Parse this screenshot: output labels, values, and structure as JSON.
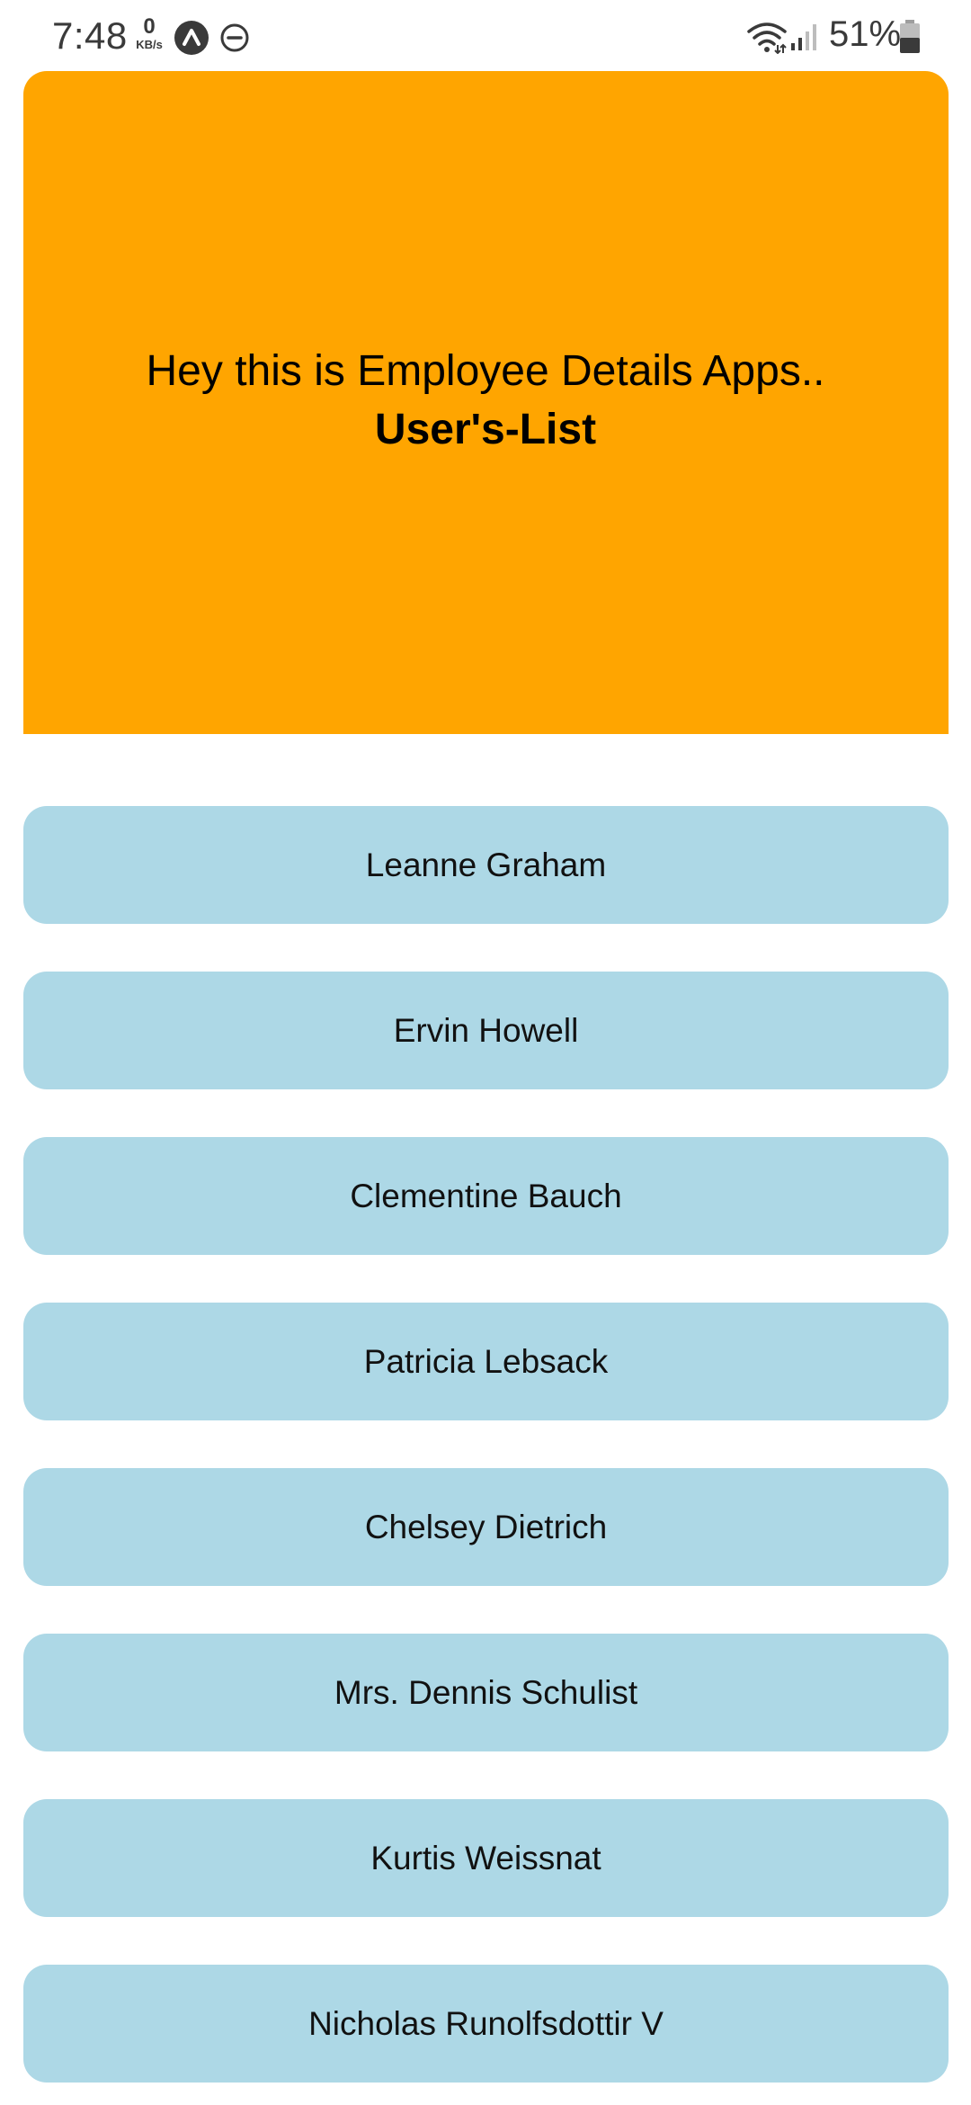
{
  "status_bar": {
    "time": "7:48",
    "net_speed_value": "0",
    "net_speed_unit": "KB/s",
    "battery_percent": "51%",
    "icons": [
      "app-notification-icon",
      "do-not-disturb-icon",
      "wifi-icon",
      "signal-icon",
      "battery-icon"
    ]
  },
  "header": {
    "title": "Hey this is Employee Details Apps..",
    "subtitle": "User's-List",
    "background_color": "#ffa500"
  },
  "users": [
    {
      "name": "Leanne Graham"
    },
    {
      "name": "Ervin Howell"
    },
    {
      "name": "Clementine Bauch"
    },
    {
      "name": "Patricia Lebsack"
    },
    {
      "name": "Chelsey Dietrich"
    },
    {
      "name": "Mrs. Dennis Schulist"
    },
    {
      "name": "Kurtis Weissnat"
    },
    {
      "name": "Nicholas Runolfsdottir V"
    }
  ],
  "colors": {
    "list_item_background": "#add8e6",
    "page_background": "#ffffff"
  }
}
